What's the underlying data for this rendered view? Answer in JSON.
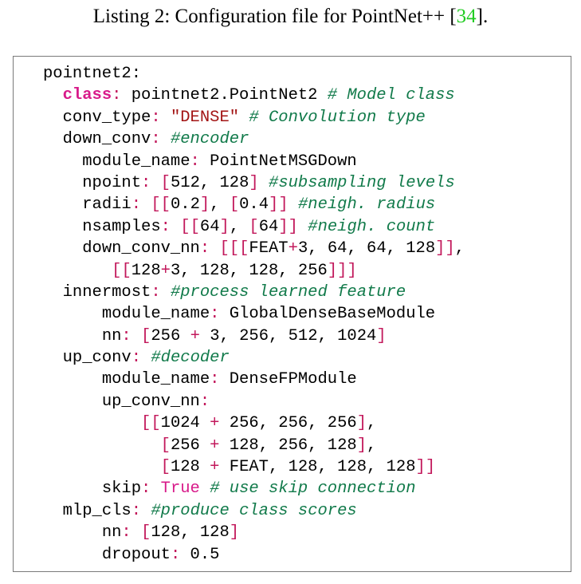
{
  "caption": {
    "prefix": "Listing 2: Configuration file for PointNet++ [",
    "ref": "34",
    "suffix": "]."
  },
  "code": {
    "lines": [
      "pointnet2:",
      "  class: pointnet2.PointNet2 # Model class",
      "  conv_type: \"DENSE\" # Convolution type",
      "  down_conv: #encoder",
      "    module_name: PointNetMSGDown",
      "    npoint: [512, 128] #subsampling levels",
      "    radii: [[0.2], [0.4]] #neigh. radius",
      "    nsamples: [[64], [64]] #neigh. count",
      "    down_conv_nn: [[[FEAT+3, 64, 64, 128]],",
      "       [[128+3, 128, 128, 256]]]",
      "  innermost: #process learned feature",
      "      module_name: GlobalDenseBaseModule",
      "      nn: [256 + 3, 256, 512, 1024]",
      "  up_conv: #decoder",
      "      module_name: DenseFPModule",
      "      up_conv_nn:",
      "          [[1024 + 256, 256, 256],",
      "            [256 + 128, 256, 128],",
      "            [128 + FEAT, 128, 128, 128]]",
      "      skip: True # use skip connection",
      "  mlp_cls: #produce class scores",
      "      nn: [128, 128]",
      "      dropout: 0.5"
    ]
  }
}
